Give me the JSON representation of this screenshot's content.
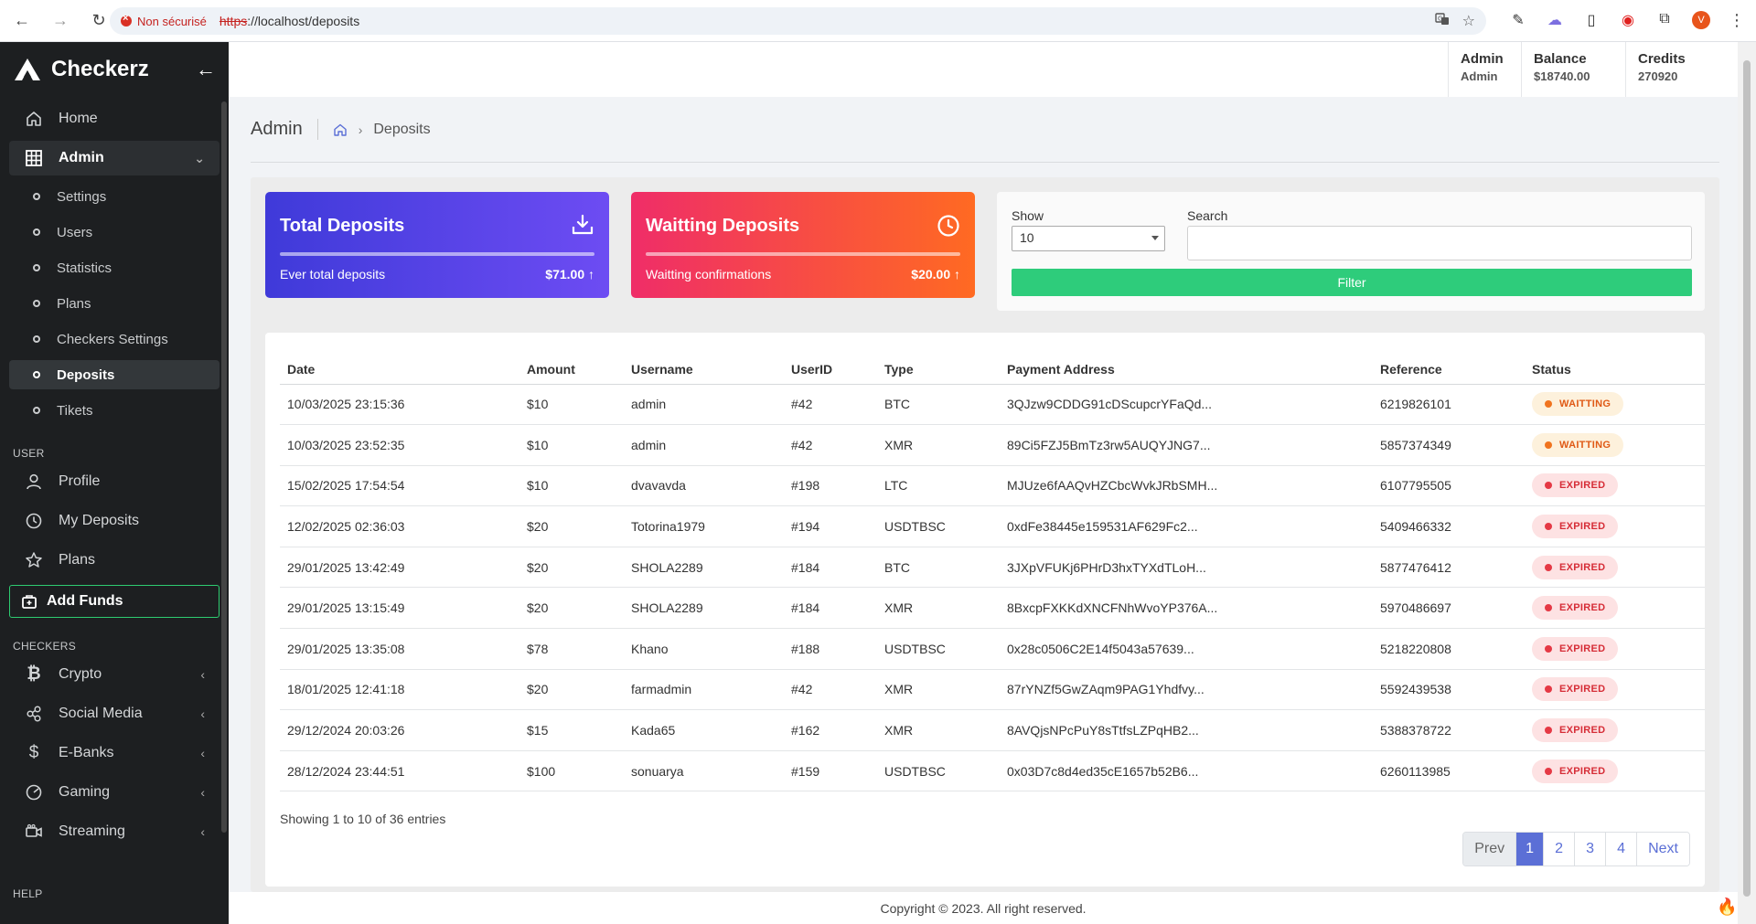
{
  "browser": {
    "security_label": "Non sécurisé",
    "url_scheme": "https",
    "url_rest": "://localhost/deposits",
    "profile_initial": "V"
  },
  "brand": {
    "name": "Checkerz"
  },
  "sidebar": {
    "items": [
      {
        "label": "Home",
        "icon": "home-icon"
      },
      {
        "label": "Admin",
        "icon": "grid-icon"
      }
    ],
    "admin_sub": [
      "Settings",
      "Users",
      "Statistics",
      "Plans",
      "Checkers Settings",
      "Deposits",
      "Tikets"
    ],
    "user_section": "USER",
    "user_items": [
      "Profile",
      "My Deposits",
      "Plans"
    ],
    "add_funds": "Add Funds",
    "checkers_section": "CHECKERS",
    "checkers_items": [
      "Crypto",
      "Social Media",
      "E-Banks",
      "Gaming",
      "Streaming"
    ],
    "help_section": "HELP"
  },
  "header": {
    "stats": [
      {
        "label": "Admin",
        "value": "Admin"
      },
      {
        "label": "Balance",
        "value": "$18740.00"
      },
      {
        "label": "Credits",
        "value": "270920"
      }
    ]
  },
  "breadcrumb": {
    "title": "Admin",
    "current": "Deposits"
  },
  "cards": {
    "total": {
      "title": "Total Deposits",
      "sub": "Ever total deposits",
      "amount": "$71.00"
    },
    "waiting": {
      "title": "Waitting Deposits",
      "sub": "Waitting confirmations",
      "amount": "$20.00"
    }
  },
  "filter": {
    "show_label": "Show",
    "show_value": "10",
    "search_label": "Search",
    "search_value": "",
    "button": "Filter"
  },
  "table": {
    "columns": [
      "Date",
      "Amount",
      "Username",
      "UserID",
      "Type",
      "Payment Address",
      "Reference",
      "Status"
    ],
    "rows": [
      [
        "10/03/2025 23:15:36",
        "$10",
        "admin",
        "#42",
        "BTC",
        "3QJzw9CDDG91cDScupcrYFaQd...",
        "6219826101",
        "WAITTING"
      ],
      [
        "10/03/2025 23:52:35",
        "$10",
        "admin",
        "#42",
        "XMR",
        "89Ci5FZJ5BmTz3rw5AUQYJNG7...",
        "5857374349",
        "WAITTING"
      ],
      [
        "15/02/2025 17:54:54",
        "$10",
        "dvavavda",
        "#198",
        "LTC",
        "MJUze6fAAQvHZCbcWvkJRbSMH...",
        "6107795505",
        "EXPIRED"
      ],
      [
        "12/02/2025 02:36:03",
        "$20",
        "Totorina1979",
        "#194",
        "USDTBSC",
        "0xdFe38445e159531AF629Fc2...",
        "5409466332",
        "EXPIRED"
      ],
      [
        "29/01/2025 13:42:49",
        "$20",
        "SHOLA2289",
        "#184",
        "BTC",
        "3JXpVFUKj6PHrD3hxTYXdTLoH...",
        "5877476412",
        "EXPIRED"
      ],
      [
        "29/01/2025 13:15:49",
        "$20",
        "SHOLA2289",
        "#184",
        "XMR",
        "8BxcpFXKKdXNCFNhWvoYP376A...",
        "5970486697",
        "EXPIRED"
      ],
      [
        "29/01/2025 13:35:08",
        "$78",
        "Khano",
        "#188",
        "USDTBSC",
        "0x28c0506C2E14f5043a57639...",
        "5218220808",
        "EXPIRED"
      ],
      [
        "18/01/2025 12:41:18",
        "$20",
        "farmadmin",
        "#42",
        "XMR",
        "87rYNZf5GwZAqm9PAG1Yhdfvy...",
        "5592439538",
        "EXPIRED"
      ],
      [
        "29/12/2024 20:03:26",
        "$15",
        "Kada65",
        "#162",
        "XMR",
        "8AVQjsNPcPuY8sTtfsLZPqHB2...",
        "5388378722",
        "EXPIRED"
      ],
      [
        "28/12/2024 23:44:51",
        "$100",
        "sonuarya",
        "#159",
        "USDTBSC",
        "0x03D7c8d4ed35cE1657b52B6...",
        "6260113985",
        "EXPIRED"
      ]
    ]
  },
  "pagination": {
    "showing": "Showing 1 to 10 of 36 entries",
    "prev": "Prev",
    "pages": [
      "1",
      "2",
      "3",
      "4"
    ],
    "active": "1",
    "next": "Next"
  },
  "footer": {
    "text": "Copyright © 2023. All right reserved."
  },
  "colors": {
    "sidebar_bg": "#1d1f21",
    "accent": "#5b6fd6",
    "success": "#2ecc7b",
    "waiting": "#f0741f",
    "expired": "#e53945"
  }
}
